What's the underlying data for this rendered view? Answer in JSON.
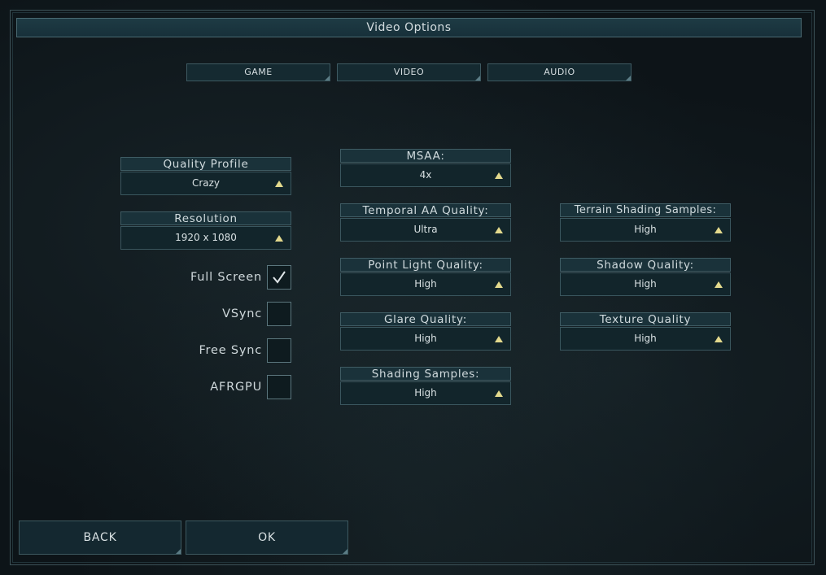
{
  "window": {
    "title": "Video Options"
  },
  "tabs": [
    {
      "label": "GAME"
    },
    {
      "label": "VIDEO"
    },
    {
      "label": "AUDIO"
    }
  ],
  "settings": {
    "quality_profile": {
      "label": "Quality Profile",
      "value": "Crazy"
    },
    "resolution": {
      "label": "Resolution",
      "value": "1920 x 1080"
    },
    "msaa": {
      "label": "MSAA:",
      "value": "4x"
    },
    "temporal_aa": {
      "label": "Temporal AA Quality:",
      "value": "Ultra"
    },
    "point_light": {
      "label": "Point Light Quality:",
      "value": "High"
    },
    "glare": {
      "label": "Glare Quality:",
      "value": "High"
    },
    "shading_samples": {
      "label": "Shading Samples:",
      "value": "High"
    },
    "terrain_shading": {
      "label": "Terrain Shading Samples:",
      "value": "High"
    },
    "shadow": {
      "label": "Shadow Quality:",
      "value": "High"
    },
    "texture": {
      "label": "Texture Quality",
      "value": "High"
    }
  },
  "checkboxes": {
    "full_screen": {
      "label": "Full Screen",
      "checked": true
    },
    "vsync": {
      "label": "VSync",
      "checked": false
    },
    "free_sync": {
      "label": "Free Sync",
      "checked": false
    },
    "afrgpu": {
      "label": "AFRGPU",
      "checked": false
    }
  },
  "buttons": {
    "back": "BACK",
    "ok": "OK"
  },
  "colors": {
    "accent_arrow": "#e3d98d",
    "panel": "#12252b",
    "border": "#3a565e"
  },
  "icons": {
    "dropdown": "triangle-up-icon",
    "check": "check-icon"
  }
}
